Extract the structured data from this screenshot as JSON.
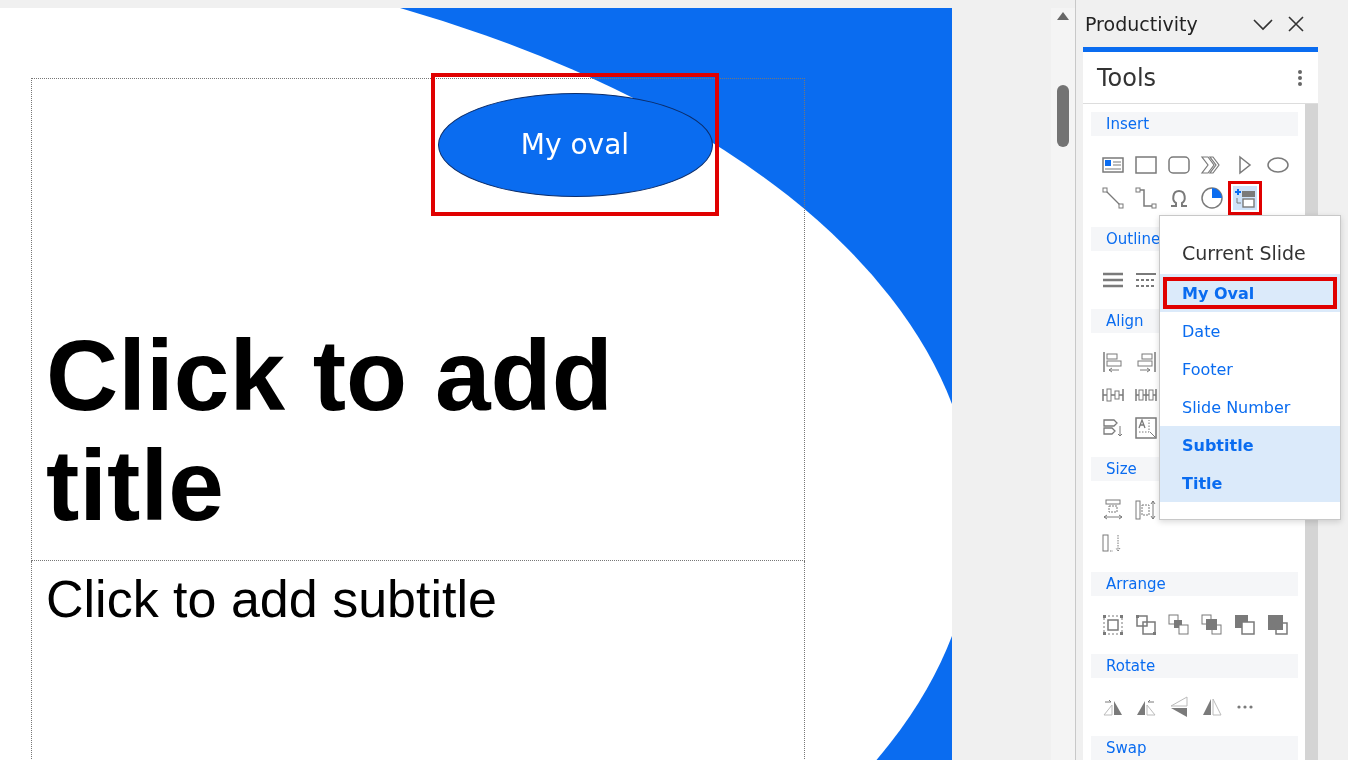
{
  "slide": {
    "oval": {
      "label": "My oval",
      "highlighted": true
    },
    "title": "Click to add title",
    "subtitle": "Click to add subtitle"
  },
  "panel": {
    "title": "Productivity",
    "heading": "Tools"
  },
  "sections": [
    {
      "label": "Insert",
      "kind": "insert",
      "last_tool_highlighted": true
    },
    {
      "label": "Outline",
      "kind": "outline"
    },
    {
      "label": "Align",
      "kind": "align"
    },
    {
      "label": "Size",
      "kind": "size"
    },
    {
      "label": "Arrange",
      "kind": "arrange"
    },
    {
      "label": "Rotate",
      "kind": "rotate"
    },
    {
      "label": "Swap",
      "kind": "swap"
    }
  ],
  "menu": {
    "header": "Current Slide",
    "items": [
      {
        "label": "My Oval",
        "selected": true,
        "highlighted": true
      },
      {
        "label": "Date",
        "selected": false,
        "highlighted": false
      },
      {
        "label": "Footer",
        "selected": false,
        "highlighted": false
      },
      {
        "label": "Slide Number",
        "selected": false,
        "highlighted": false
      },
      {
        "label": "Subtitle",
        "selected": true,
        "highlighted": false
      },
      {
        "label": "Title",
        "selected": true,
        "highlighted": false
      }
    ]
  }
}
